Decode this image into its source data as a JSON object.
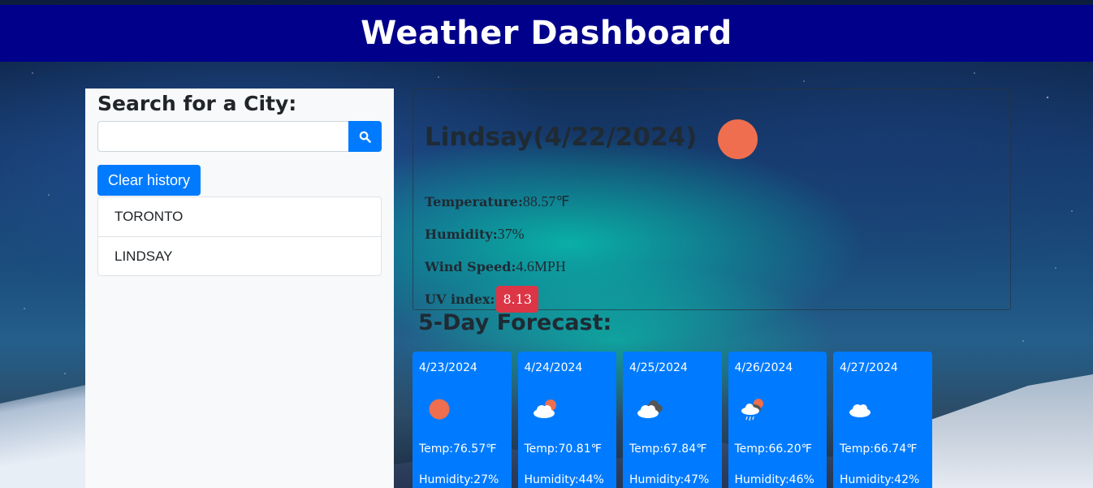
{
  "app": {
    "title": "Weather Dashboard"
  },
  "sidebar": {
    "heading": "Search for a City:",
    "search": {
      "value": "",
      "placeholder": ""
    },
    "clear_label": "Clear history",
    "history": [
      "TORONTO",
      "LINDSAY"
    ]
  },
  "current": {
    "title": "Lindsay(4/22/2024)",
    "icon": "sun-icon",
    "temperature_label": "Temperature:",
    "temperature": "88.57℉",
    "humidity_label": "Humidity:",
    "humidity": "37%",
    "wind_label": "Wind Speed:",
    "wind": "4.6MPH",
    "uv_label": "UV index:",
    "uv": "8.13",
    "uv_color": "#dc3545"
  },
  "forecast": {
    "heading": "5-Day Forecast:",
    "days": [
      {
        "date": "4/23/2024",
        "icon": "sun-icon",
        "temp": "Temp:76.57℉",
        "humidity": "Humidity:27%"
      },
      {
        "date": "4/24/2024",
        "icon": "partly-cloudy-icon",
        "temp": "Temp:70.81℉",
        "humidity": "Humidity:44%"
      },
      {
        "date": "4/25/2024",
        "icon": "cloudy-icon",
        "temp": "Temp:67.84℉",
        "humidity": "Humidity:47%"
      },
      {
        "date": "4/26/2024",
        "icon": "rain-icon",
        "temp": "Temp:66.20℉",
        "humidity": "Humidity:46%"
      },
      {
        "date": "4/27/2024",
        "icon": "cloud-icon",
        "temp": "Temp:66.74℉",
        "humidity": "Humidity:42%"
      }
    ]
  },
  "colors": {
    "header": "#00008b",
    "accent": "#007bff",
    "sun": "#ee6e4f"
  }
}
